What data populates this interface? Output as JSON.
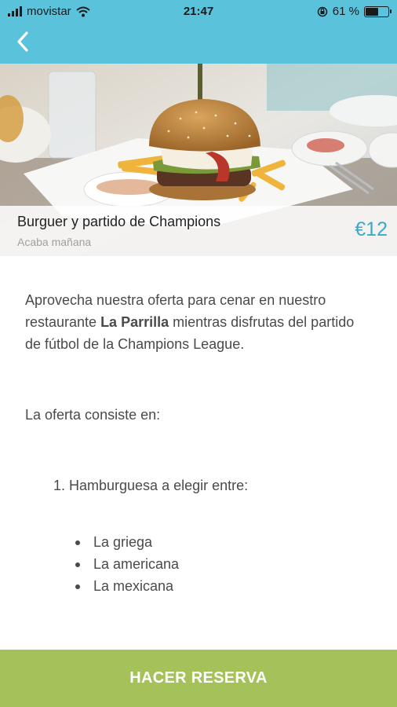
{
  "status_bar": {
    "carrier": "movistar",
    "time": "21:47",
    "battery_percent": "61 %",
    "battery_level": 0.61
  },
  "nav": {
    "back_icon": "chevron-left-icon",
    "accent_color": "#5bc2dc"
  },
  "deal": {
    "title": "Burguer y partido de Champions",
    "subtitle": "Acaba mañana",
    "price": "€12",
    "price_color": "#3aa9c7"
  },
  "description": {
    "intro_prefix": "Aprovecha nuestra oferta para cenar en nuestro restaurante ",
    "restaurant": "La Parrilla",
    "intro_suffix": " mientras disfrutas del partido de fútbol de la Champions League.",
    "lead": "La oferta consiste en:",
    "ordered_items": [
      "Hamburguesa a elegir entre:"
    ],
    "options": [
      "La griega",
      "La americana",
      "La mexicana"
    ]
  },
  "cta": {
    "label": "HACER RESERVA",
    "color": "#a4c259"
  }
}
